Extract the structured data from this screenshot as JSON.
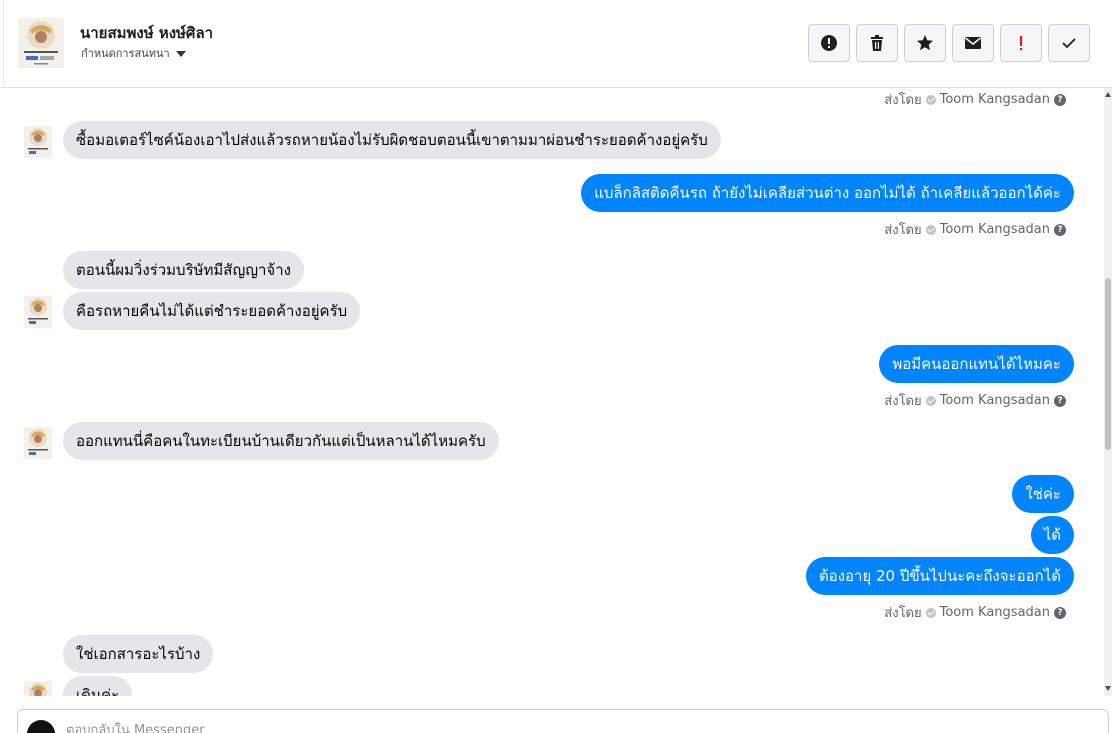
{
  "header": {
    "contact_name": "นายสมพงษ์ หงษ์ศิลา",
    "subtitle": "กำหนดการสนทนา",
    "toolbar": {
      "spam_icon": "exclamation-circle-icon",
      "delete_icon": "trash-icon",
      "star_icon": "star-icon",
      "unread_icon": "envelope-icon",
      "important_icon": "exclamation-icon",
      "done_icon": "check-icon",
      "important_color": "#e02020"
    }
  },
  "sent_by_prefix": "ส่งโดย",
  "sent_by_name": "Toom Kangsadan",
  "messages": [
    {
      "dir": "in",
      "text": "ซื้อมอเตอร์ไซค์น้องเอาไปส่งแล้วรถหายน้องไม่รับผิดชอบตอนนี้เขาตามมาผ่อนชำระยอดค้างอยู่ครับ"
    },
    {
      "dir": "out",
      "text": "แบล็กลิสติดคืนรถ ถ้ายังไม่เคลียส่วนต่าง ออกไม่ได้ ถ้าเคลียแล้วออกได้ค่ะ"
    },
    {
      "dir": "in",
      "text": "ตอนนี้ผมวิ่งร่วมบริษัทมีสัญญาจ้าง"
    },
    {
      "dir": "in",
      "text": "คือรถหายคืนไม่ได้แต่ชำระยอดค้างอยู่ครับ"
    },
    {
      "dir": "out",
      "text": "พอมีคนออกแทนได้ไหมคะ"
    },
    {
      "dir": "in",
      "text": "ออกแทนนี่คือคนในทะเบียนบ้านเดียวกันแต่เป็นหลานได้ไหมครับ"
    },
    {
      "dir": "out",
      "text": "ใช่ค่ะ"
    },
    {
      "dir": "out",
      "text": "ได้"
    },
    {
      "dir": "out",
      "text": "ต้องอายุ 20 ปีขึ้นไปนะคะถึงจะออกได้"
    },
    {
      "dir": "in",
      "text": "ใช่เอกสารอะไรบ้าง"
    },
    {
      "dir": "in",
      "text": "เดินค่ะ"
    }
  ],
  "composer": {
    "placeholder": "ตอบกลับใน Messenger"
  },
  "colors": {
    "outgoing_bubble": "#0084ff",
    "incoming_bubble": "#e4e6eb"
  }
}
